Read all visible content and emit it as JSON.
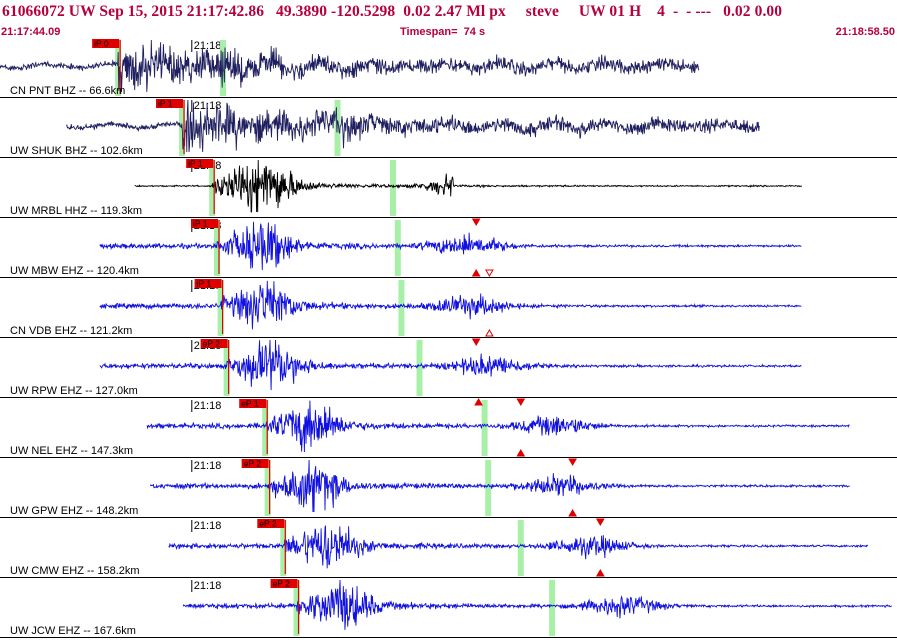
{
  "header": {
    "title": "61066072 UW Sep 15, 2015 21:17:42.86   49.3890 -120.5298  0.02 2.47 Ml px     steve     UW 01 H    4  -  - ---   0.02 0.00",
    "start_time": "21:17:44.09",
    "timespan": "Timespan=  74 s",
    "end_time": "21:18:58.50"
  },
  "chart_data": {
    "type": "seismogram",
    "time_range_s": [
      0,
      74.41
    ],
    "minute_tick_label": "21:18",
    "minute_tick_time_s": 15.91,
    "colors": {
      "header_text": "#b4003c",
      "pick_box": "#e00000",
      "window": "#a8f0a8"
    },
    "traces": [
      {
        "label": "CN PNT BHZ -- 66.6km",
        "color": "#202060",
        "start_s": 0.0,
        "end_s": 58.0,
        "p_time_s": 9.8,
        "s_time_s": 18.5,
        "pick": "iP 0",
        "trace_type": "long",
        "markers": []
      },
      {
        "label": "UW SHUK BHZ -- 102.6km",
        "color": "#202060",
        "start_s": 5.5,
        "end_s": 63.0,
        "p_time_s": 15.1,
        "s_time_s": 28.0,
        "pick": "iP 1",
        "trace_type": "long",
        "markers": []
      },
      {
        "label": "UW MRBL HHZ -- 119.3km",
        "color": "#000000",
        "start_s": 11.2,
        "end_s": 66.5,
        "p_time_s": 17.6,
        "s_time_s": 32.6,
        "pick": "iP 1",
        "trace_type": "black",
        "markers": []
      },
      {
        "label": "UW MBW EHZ -- 120.4km",
        "color": "#1010e0",
        "start_s": 8.3,
        "end_s": 66.5,
        "p_time_s": 18.0,
        "s_time_s": 33.0,
        "pick": "iP 1",
        "trace_type": "blue",
        "markers": [
          {
            "time_s": 39.5,
            "pos": "top",
            "kind": "down"
          },
          {
            "time_s": 39.5,
            "pos": "bottom",
            "kind": "up"
          },
          {
            "time_s": 40.6,
            "pos": "bottom",
            "kind": "hollow-down"
          }
        ]
      },
      {
        "label": "CN VDB EHZ -- 121.2km",
        "color": "#1010e0",
        "start_s": 8.3,
        "end_s": 66.5,
        "p_time_s": 18.3,
        "s_time_s": 33.3,
        "pick": "iP 1",
        "trace_type": "blue",
        "markers": [
          {
            "time_s": 40.6,
            "pos": "bottom",
            "kind": "hollow-up"
          }
        ]
      },
      {
        "label": "UW RPW EHZ -- 127.0km",
        "color": "#1010e0",
        "start_s": 8.3,
        "end_s": 66.5,
        "p_time_s": 18.8,
        "s_time_s": 34.8,
        "pick": "eP 2",
        "trace_type": "blue",
        "markers": [
          {
            "time_s": 39.5,
            "pos": "top",
            "kind": "down"
          }
        ]
      },
      {
        "label": "UW NEL EHZ -- 147.3km",
        "color": "#1010e0",
        "start_s": 12.2,
        "end_s": 70.5,
        "p_time_s": 22.0,
        "s_time_s": 40.2,
        "pick": "eP 1",
        "trace_type": "blue",
        "markers": [
          {
            "time_s": 39.7,
            "pos": "top",
            "kind": "up"
          },
          {
            "time_s": 43.2,
            "pos": "top",
            "kind": "down"
          },
          {
            "time_s": 43.2,
            "pos": "bottom",
            "kind": "up"
          }
        ]
      },
      {
        "label": "UW GPW EHZ -- 148.2km",
        "color": "#1010e0",
        "start_s": 12.5,
        "end_s": 70.5,
        "p_time_s": 22.2,
        "s_time_s": 40.5,
        "pick": "eP 2",
        "trace_type": "blue",
        "markers": [
          {
            "time_s": 47.5,
            "pos": "top",
            "kind": "down"
          },
          {
            "time_s": 47.5,
            "pos": "bottom",
            "kind": "up"
          }
        ]
      },
      {
        "label": "UW CMW EHZ -- 158.2km",
        "color": "#1010e0",
        "start_s": 14.0,
        "end_s": 72.0,
        "p_time_s": 23.5,
        "s_time_s": 43.2,
        "pick": "eP 2",
        "trace_type": "blue",
        "markers": [
          {
            "time_s": 49.8,
            "pos": "top",
            "kind": "down"
          },
          {
            "time_s": 49.8,
            "pos": "bottom",
            "kind": "up"
          }
        ]
      },
      {
        "label": "UW JCW EHZ -- 167.6km",
        "color": "#1010e0",
        "start_s": 15.2,
        "end_s": 74.0,
        "p_time_s": 24.6,
        "s_time_s": 45.8,
        "pick": "eP 2",
        "trace_type": "blue",
        "markers": []
      }
    ]
  }
}
